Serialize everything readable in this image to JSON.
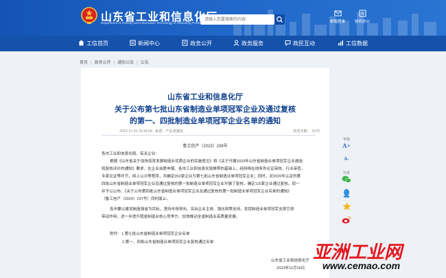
{
  "header": {
    "site_name": "山东省工业和信息化厅",
    "site_name_en": "Department of Industry and Information Technology of Shandong Province",
    "search_placeholder": "请输入您要搜索的内容",
    "links": [
      {
        "label": "邮箱登录",
        "icon": "mail-icon"
      },
      {
        "label": "协同办公",
        "icon": "office-icon"
      }
    ],
    "colors": {
      "primary": "#1553b5",
      "nav": "#1552ac",
      "title": "#0d3f8f"
    }
  },
  "nav": [
    {
      "label": "工信首页",
      "icon": "home-icon"
    },
    {
      "label": "新闻中心",
      "icon": "news-icon"
    },
    {
      "label": "政务公开",
      "icon": "open-icon"
    },
    {
      "label": "政务服务",
      "icon": "service-icon"
    },
    {
      "label": "政民互动",
      "icon": "interact-icon"
    },
    {
      "label": "工信数据",
      "icon": "data-icon"
    }
  ],
  "breadcrumb": [
    "首页",
    "政务公开",
    "通知公告",
    "公告"
  ],
  "article": {
    "title_1": "山东省工业和信息化厅",
    "title_2": "关于公布第七批山东省制造业单项冠军企业及通过复核",
    "title_3": "的第一、四批制造业单项冠军企业名单的通知",
    "date": "2023-11-16 15:34:09",
    "source": "来源：产业发展处",
    "views": "浏览次数：  1576",
    "doc_no": "鲁工信产〔2023〕238号",
    "paragraphs": [
      "各市工业和信息化局、有关企业：",
      "根据《山东省关于加快培育发展制造业优质企业的实施意见》和《关于开展2023年山东省制造业单项冠军企业遴选",
      "和复核评价的通知》要求，在企业自愿申报、各市工业和信息化局推荐的基础上，经网络在线条件论证审核，行业审查，",
      "专家论证等环节，网上公示等程序，共确定352家企业为第七批山东省制造业单项冠军企业；同时，对2020年认定的第",
      "四批山东省制造业单项冠军企业及通过复核的第一批制造业单项冠军企业开展了复核，确定115家企业通过复核。现一",
      "并予以公布。《关于公布第四批山东省制造业单项冠军企业及通过复核的第一批制造业单项冠军企业名单的通知》",
      "（鲁工信产〔2020〕237号）同时废止。",
      "各市要以建设制造强省为目标，坚持市场导向、突出企业主体、强化政策支持，发挥制造业单项冠军支撑引领",
      "带动作用，进一步提升我省制造业核心竞争力、加快推动全省制造业高质量发展。"
    ],
    "attachments": [
      "附件：1.第七批山东省制造业单项冠军企业名单",
      "2.第一、四批山东省制造业单项冠军企业复核通过名单"
    ],
    "signature_org": "山东省工业和信息化厅",
    "signature_date": "2023年11月15日"
  },
  "tools": {
    "font_label": "字体",
    "font_big": "A+",
    "font_small": "A-",
    "share_label": "分享"
  },
  "watermark": {
    "cn": "亚洲工业网",
    "url": "www.cemao.com"
  }
}
